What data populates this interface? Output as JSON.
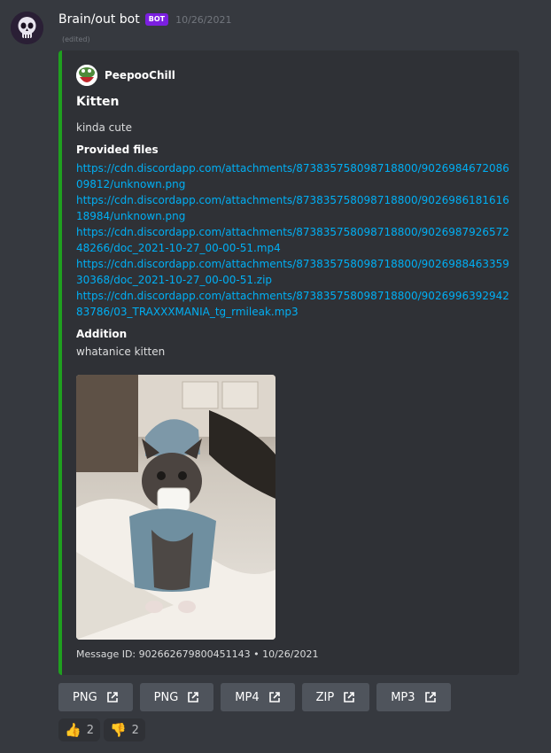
{
  "message": {
    "username": "Brain/out bot",
    "bot_badge": "BOT",
    "timestamp": "10/26/2021",
    "edited": "(edited)"
  },
  "embed": {
    "accent_color": "#1fa01f",
    "author_name": "PeepooChill",
    "title": "Kitten",
    "description": "kinda cute",
    "field1_name": "Provided files",
    "links": [
      "https://cdn.discordapp.com/attachments/873835758098718800/902698467208609812/unknown.png",
      "https://cdn.discordapp.com/attachments/873835758098718800/902698618161618984/unknown.png",
      "https://cdn.discordapp.com/attachments/873835758098718800/902698792657248266/doc_2021-10-27_00-00-51.mp4",
      "https://cdn.discordapp.com/attachments/873835758098718800/902698846335930368/doc_2021-10-27_00-00-51.zip",
      "https://cdn.discordapp.com/attachments/873835758098718800/902699639294283786/03_TRAXXXMANIA_tg_rmileak.mp3"
    ],
    "field2_name": "Addition",
    "field2_value": "whatanice kitten",
    "footer": "Message ID: 902662679800451143 • 10/26/2021"
  },
  "buttons": [
    "PNG",
    "PNG",
    "MP4",
    "ZIP",
    "MP3"
  ],
  "reactions": [
    {
      "emoji": "👍",
      "count": "2"
    },
    {
      "emoji": "👎",
      "count": "2"
    }
  ]
}
